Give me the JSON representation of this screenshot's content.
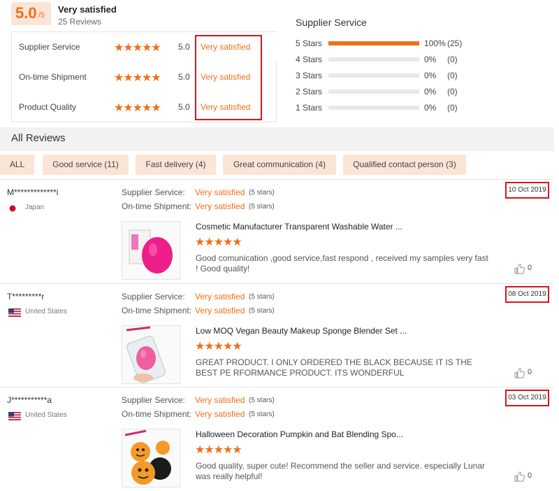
{
  "summary": {
    "score": "5.0",
    "score_max": "/5",
    "overall_label": "Very satisfied",
    "review_count": "25 Reviews",
    "rows": [
      {
        "name": "Supplier Service",
        "stars": "★★★★★",
        "score": "5.0",
        "status": "Very satisfied"
      },
      {
        "name": "On-time Shipment",
        "stars": "★★★★★",
        "score": "5.0",
        "status": "Very satisfied"
      },
      {
        "name": "Product Quality",
        "stars": "★★★★★",
        "score": "5.0",
        "status": "Very satisfied"
      }
    ]
  },
  "distribution": {
    "title": "Supplier Service",
    "rows": [
      {
        "label": "5 Stars",
        "fraction": 1.0,
        "pct": "100%",
        "count": "(25)"
      },
      {
        "label": "4 Stars",
        "fraction": 0,
        "pct": "0%",
        "count": "(0)"
      },
      {
        "label": "3 Stars",
        "fraction": 0,
        "pct": "0%",
        "count": "(0)"
      },
      {
        "label": "2 Stars",
        "fraction": 0,
        "pct": "0%",
        "count": "(0)"
      },
      {
        "label": "1 Stars",
        "fraction": 0,
        "pct": "0%",
        "count": "(0)"
      }
    ]
  },
  "all_reviews": {
    "title": "All Reviews",
    "filters": [
      "ALL",
      "Good service (11)",
      "Fast delivery (4)",
      "Great communication (4)",
      "Qualified contact person (3)"
    ]
  },
  "reviews": [
    {
      "user": "M*************i",
      "country": "Japan",
      "k1": "Supplier Service:",
      "v1": "Very satisfied",
      "s1": "(5 stars)",
      "k2": "On-time Shipment:",
      "v2": "Very satisfied",
      "s2": "(5 stars)",
      "date": "10 Oct 2019",
      "product": "Cosmetic Manufacturer Transparent Washable Water ...",
      "stars": "★★★★★",
      "text": "Good comunication ,good service,fast respond , received  my samples very fast ! Good quality!",
      "likes": "0"
    },
    {
      "user": "T*********r",
      "country": "United States",
      "k1": "Supplier Service:",
      "v1": "Very satisfied",
      "s1": "(5 stars)",
      "k2": "On-time Shipment:",
      "v2": "Very satisfied",
      "s2": "(5 stars)",
      "date": "08 Oct 2019",
      "product": "Low MOQ Vegan Beauty Makeup Sponge Blender Set ...",
      "stars": "★★★★★",
      "text": "GREAT PRODUCT.  I ONLY ORDERED THE BLACK BECAUSE IT IS THE BEST PE RFORMANCE PRODUCT.  ITS WONDERFUL",
      "likes": "0"
    },
    {
      "user": "J***********a",
      "country": "United States",
      "k1": "Supplier Service:",
      "v1": "Very satisfied",
      "s1": "(5 stars)",
      "k2": "On-time Shipment:",
      "v2": "Very satisfied",
      "s2": "(5 stars)",
      "date": "03 Oct 2019",
      "product": "Halloween Decoration Pumpkin and Bat Blending Spo...",
      "stars": "★★★★★",
      "text": "Good quality, super cute! Recommend the seller and service. especially Lunar was really helpful!",
      "likes": "0"
    }
  ],
  "colors": {
    "accent": "#f26e18",
    "highlight_box": "#d9141a",
    "tag_bg": "#fce4d6"
  }
}
